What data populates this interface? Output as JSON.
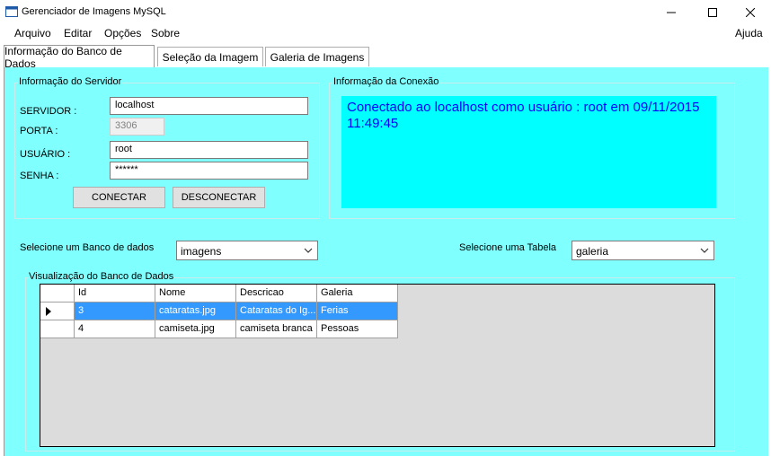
{
  "window": {
    "title": "Gerenciador de Imagens MySQL",
    "minimize": "—",
    "maximize": "☐",
    "close": "✕"
  },
  "menu": {
    "arquivo": "Arquivo",
    "editar": "Editar",
    "opcoes": "Opções",
    "sobre": "Sobre",
    "ajuda": "Ajuda"
  },
  "tabs": [
    "Informação do Banco de Dados",
    "Seleção da Imagem",
    "Galeria de Imagens"
  ],
  "server": {
    "legend": "Informação do Servidor",
    "servidor_label": "SERVIDOR :",
    "servidor_value": "localhost",
    "porta_label": "PORTA :",
    "porta_value": "3306",
    "usuario_label": "USUÁRIO :",
    "usuario_value": "root",
    "senha_label": "SENHA :",
    "senha_value": "******",
    "connect_label": "CONECTAR",
    "disconnect_label": "DESCONECTAR"
  },
  "connection": {
    "legend": "Informação da Conexão",
    "status_line1": "Conectado ao localhost como usuário : root em 09/11/2015",
    "status_line2": "11:49:45"
  },
  "selectors": {
    "db_label": "Selecione um Banco de dados",
    "db_value": "imagens",
    "table_label": "Selecione uma Tabela",
    "table_value": "galeria"
  },
  "grid": {
    "legend": "Visualização do Banco de Dados",
    "columns": [
      "Id",
      "Nome",
      "Descricao",
      "Galeria"
    ],
    "rows": [
      [
        "3",
        "cataratas.jpg",
        "Cataratas do Ig...",
        "Ferias"
      ],
      [
        "4",
        "camiseta.jpg",
        "camiseta branca",
        "Pessoas"
      ]
    ],
    "selected_row": 0
  },
  "colors": {
    "panel": "#80ffff",
    "status_bg": "#00ffff",
    "status_text": "#0000ff",
    "selection": "#3399ff"
  }
}
